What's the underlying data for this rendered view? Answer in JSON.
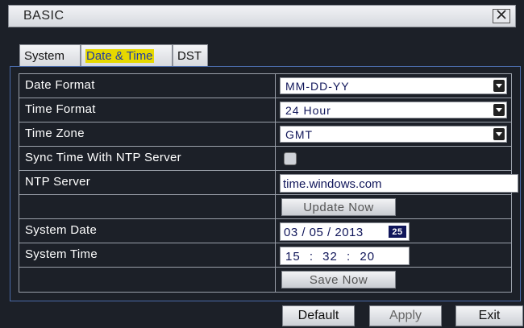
{
  "window": {
    "title": "BASIC"
  },
  "tabs": [
    {
      "label": "System",
      "active": false
    },
    {
      "label": "Date & Time",
      "active": true
    },
    {
      "label": "DST",
      "active": false
    }
  ],
  "colors": {
    "active_tab_highlight": "#e6d800",
    "panel_border": "#4a6aa8",
    "background": "#1c2028"
  },
  "form": {
    "date_format": {
      "label": "Date Format",
      "value": "MM-DD-YY"
    },
    "time_format": {
      "label": "Time Format",
      "value": "24 Hour"
    },
    "time_zone": {
      "label": "Time Zone",
      "value": "GMT"
    },
    "ntp_sync": {
      "label": "Sync Time With NTP Server",
      "checked": false
    },
    "ntp_server": {
      "label": "NTP Server",
      "value": "time.windows.com"
    },
    "update_now": {
      "label": "Update Now"
    },
    "system_date": {
      "label": "System Date",
      "value": "03 / 05 / 2013",
      "calendar_icon_text": "25"
    },
    "system_time": {
      "label": "System Time",
      "value": "15 : 32 : 20"
    },
    "save_now": {
      "label": "Save Now"
    }
  },
  "footer": {
    "default_label": "Default",
    "apply_label": "Apply",
    "exit_label": "Exit"
  },
  "icons": {
    "close": "close-icon",
    "dropdown": "chevron-down-icon",
    "calendar": "calendar-icon"
  }
}
